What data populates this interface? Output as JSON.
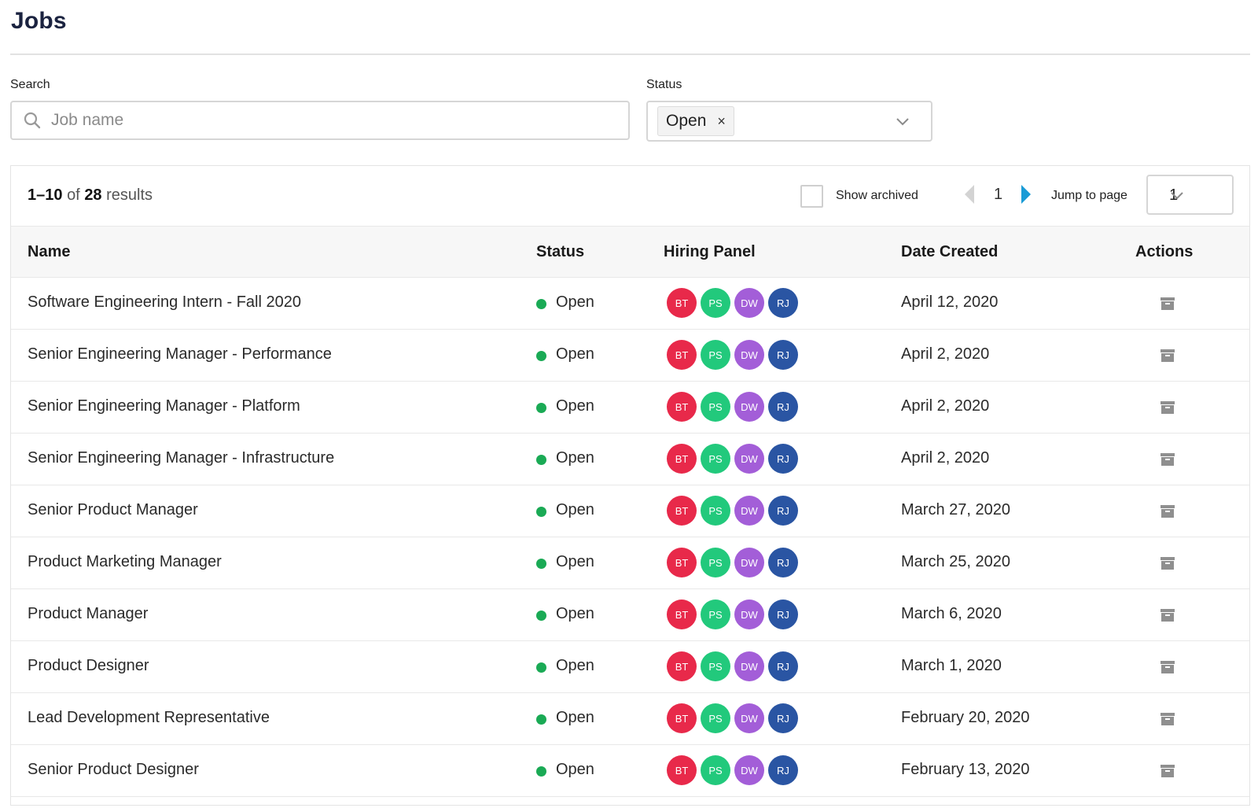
{
  "page": {
    "title": "Jobs"
  },
  "search": {
    "label": "Search",
    "placeholder": "Job name",
    "value": ""
  },
  "status_filter": {
    "label": "Status",
    "selected": "Open",
    "remove_glyph": "×"
  },
  "results": {
    "range": "1–10",
    "of": "of",
    "total": "28",
    "suffix": "results"
  },
  "archived": {
    "label": "Show archived",
    "checked": false
  },
  "pagination": {
    "current_page": "1",
    "jump_label": "Jump to page",
    "jump_value": "1"
  },
  "columns": {
    "name": "Name",
    "status": "Status",
    "panel": "Hiring Panel",
    "date": "Date Created",
    "actions": "Actions"
  },
  "panel_colors": {
    "BT": "#e8294a",
    "PS": "#22c97c",
    "DW": "#a35ed8",
    "RJ": "#2a55a3"
  },
  "accent_color": "#1a9bd6",
  "status_color": "#1aaa55",
  "rows": [
    {
      "name": "Software Engineering Intern - Fall 2020",
      "status": "Open",
      "panel": [
        "BT",
        "PS",
        "DW",
        "RJ"
      ],
      "date": "April 12, 2020",
      "action_icon": "archive-icon"
    },
    {
      "name": "Senior Engineering Manager - Performance",
      "status": "Open",
      "panel": [
        "BT",
        "PS",
        "DW",
        "RJ"
      ],
      "date": "April 2, 2020",
      "action_icon": "archive-icon"
    },
    {
      "name": "Senior Engineering Manager - Platform",
      "status": "Open",
      "panel": [
        "BT",
        "PS",
        "DW",
        "RJ"
      ],
      "date": "April 2, 2020",
      "action_icon": "archive-icon"
    },
    {
      "name": "Senior Engineering Manager - Infrastructure",
      "status": "Open",
      "panel": [
        "BT",
        "PS",
        "DW",
        "RJ"
      ],
      "date": "April 2, 2020",
      "action_icon": "archive-icon"
    },
    {
      "name": "Senior Product Manager",
      "status": "Open",
      "panel": [
        "BT",
        "PS",
        "DW",
        "RJ"
      ],
      "date": "March 27, 2020",
      "action_icon": "archive-icon"
    },
    {
      "name": "Product Marketing Manager",
      "status": "Open",
      "panel": [
        "BT",
        "PS",
        "DW",
        "RJ"
      ],
      "date": "March 25, 2020",
      "action_icon": "archive-icon"
    },
    {
      "name": "Product Manager",
      "status": "Open",
      "panel": [
        "BT",
        "PS",
        "DW",
        "RJ"
      ],
      "date": "March 6, 2020",
      "action_icon": "archive-icon"
    },
    {
      "name": "Product Designer",
      "status": "Open",
      "panel": [
        "BT",
        "PS",
        "DW",
        "RJ"
      ],
      "date": "March 1, 2020",
      "action_icon": "archive-icon"
    },
    {
      "name": "Lead Development Representative",
      "status": "Open",
      "panel": [
        "BT",
        "PS",
        "DW",
        "RJ"
      ],
      "date": "February 20, 2020",
      "action_icon": "archive-icon"
    },
    {
      "name": "Senior Product Designer",
      "status": "Open",
      "panel": [
        "BT",
        "PS",
        "DW",
        "RJ"
      ],
      "date": "February 13, 2020",
      "action_icon": "archive-icon"
    }
  ]
}
